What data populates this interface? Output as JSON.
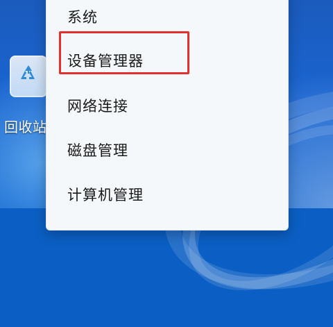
{
  "desktop": {
    "wallpaper": "windows-11-bloom",
    "recycle_bin_label": "回收站",
    "icons": {
      "recycle_bin": "recycle-bin-icon"
    }
  },
  "context_menu": {
    "items": [
      {
        "label": "系统"
      },
      {
        "label": "设备管理器",
        "highlighted": true
      },
      {
        "label": "网络连接"
      },
      {
        "label": "磁盘管理"
      },
      {
        "label": "计算机管理"
      }
    ],
    "highlight_color": "#e03030"
  }
}
